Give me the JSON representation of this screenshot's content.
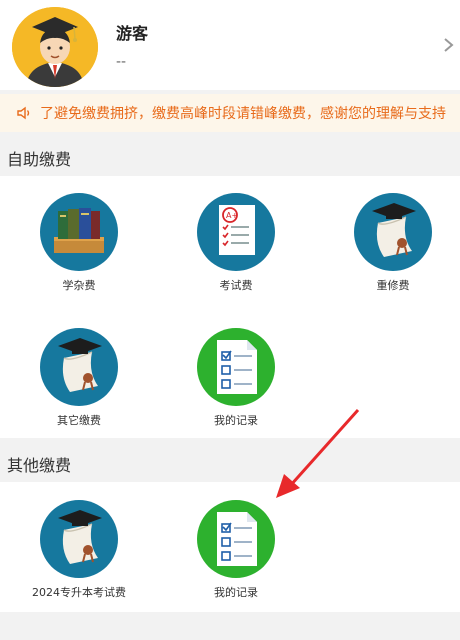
{
  "profile": {
    "name": "游客",
    "subtitle": "--"
  },
  "notice": {
    "text": "了避免缴费拥挤，缴费高峰时段请错峰缴费，感谢您的理解与支持",
    "color": "#e86b1b"
  },
  "sections": {
    "self_service": {
      "title": "自助缴费",
      "items": [
        {
          "label": "学杂费",
          "icon": "books-icon"
        },
        {
          "label": "考试费",
          "icon": "exam-paper-icon"
        },
        {
          "label": "重修费",
          "icon": "diploma-icon"
        },
        {
          "label": "其它缴费",
          "icon": "diploma-icon"
        },
        {
          "label": "我的记录",
          "icon": "checklist-icon"
        }
      ]
    },
    "other": {
      "title": "其他缴费",
      "items": [
        {
          "label": "2024专升本考试费",
          "icon": "diploma-icon"
        },
        {
          "label": "我的记录",
          "icon": "checklist-icon"
        }
      ]
    }
  },
  "colors": {
    "accent_orange": "#e86b1b",
    "icon_blue": "#16789e",
    "icon_green": "#2db12e",
    "arrow_red": "#e8292b"
  }
}
